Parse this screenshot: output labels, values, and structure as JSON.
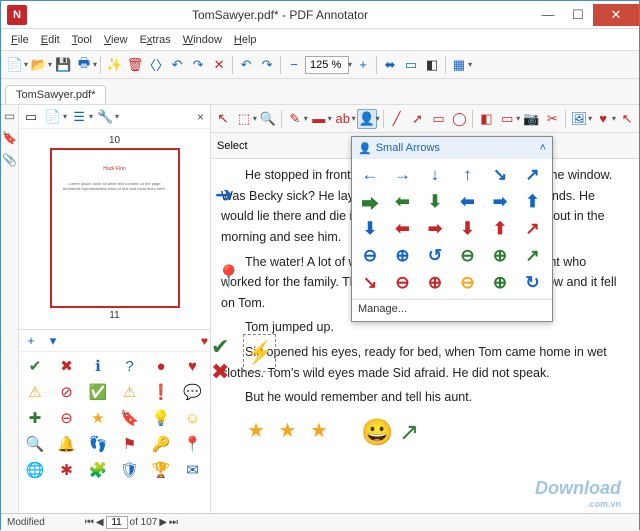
{
  "window": {
    "title": "TomSawyer.pdf* - PDF Annotator",
    "app_icon_letter": "N"
  },
  "menu": [
    "File",
    "Edit",
    "Tool",
    "View",
    "Extras",
    "Window",
    "Help"
  ],
  "toolbar": {
    "zoom_value": "125 %"
  },
  "tab": {
    "label": "TomSawyer.pdf*"
  },
  "side": {
    "thumb_num_top": "10",
    "thumb_num_bottom": "11",
    "close": "×"
  },
  "select_label": "Select",
  "popup": {
    "title": "Small Arrows",
    "manage": "Manage..."
  },
  "document": {
    "p1": "He stopped in front of the house. There was no one at the window. Was Becky sick? He lay down below the window with his hands. He would lie there and die in the cold. Becky — she would look out in the morning and see him.",
    "p2": "The water! A lot of water! He heard the voice of a servant who worked for the family. The servant threw water out the window and it fell on Tom.",
    "p3": "Tom jumped up.",
    "p4": "Sid opened his eyes, ready for bed, when Tom came home in wet clothes. Tom's wild eyes made Sid afraid. He did not speak.",
    "p5": "But he would remember and tell his aunt."
  },
  "status": {
    "modified": "Modified",
    "page_current": "11",
    "page_total": "of 107"
  },
  "watermark": {
    "main": "Download",
    "sub": ".com.vn"
  }
}
